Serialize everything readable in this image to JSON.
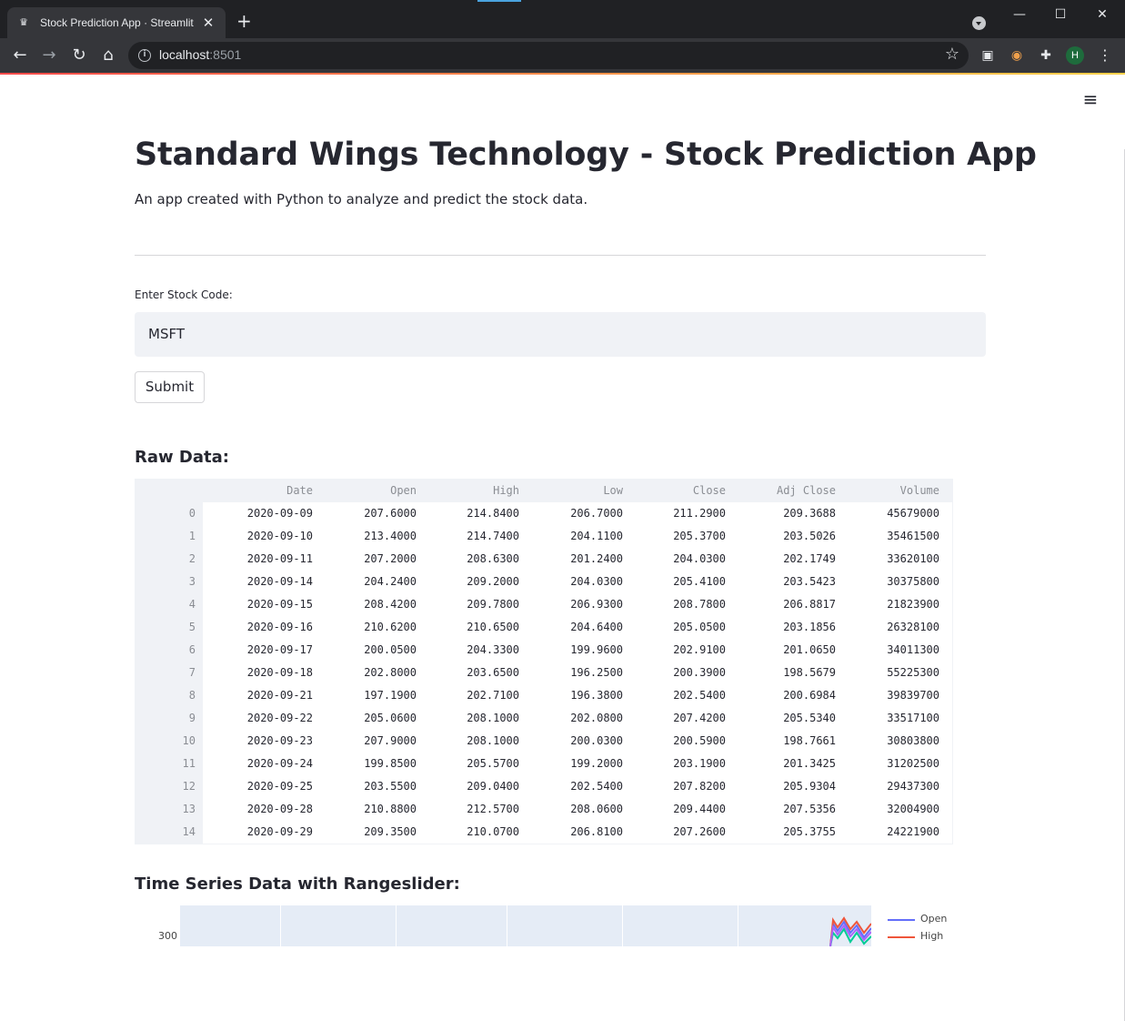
{
  "browser": {
    "tab_title": "Stock Prediction App · Streamlit",
    "tab_close": "✕",
    "new_tab": "+",
    "url_host": "localhost",
    "url_port": ":8501",
    "profile_initial": "H",
    "icons": [
      "back-arrow-icon",
      "forward-arrow-icon",
      "reload-icon",
      "home-icon",
      "info-icon",
      "star-icon",
      "reader-icon",
      "extension-icon",
      "puzzle-icon",
      "menu-dots-icon"
    ]
  },
  "app": {
    "title": "Standard Wings Technology - Stock Prediction App",
    "subtitle": "An app created with Python to analyze and predict the stock data.",
    "input_label": "Enter Stock Code:",
    "input_value": "MSFT",
    "submit_label": "Submit",
    "raw_data_heading": "Raw Data:",
    "chart_heading": "Time Series Data with Rangeslider:"
  },
  "table": {
    "columns": [
      "Date",
      "Open",
      "High",
      "Low",
      "Close",
      "Adj Close",
      "Volume"
    ],
    "rows": [
      [
        "0",
        "2020-09-09",
        "207.6000",
        "214.8400",
        "206.7000",
        "211.2900",
        "209.3688",
        "45679000"
      ],
      [
        "1",
        "2020-09-10",
        "213.4000",
        "214.7400",
        "204.1100",
        "205.3700",
        "203.5026",
        "35461500"
      ],
      [
        "2",
        "2020-09-11",
        "207.2000",
        "208.6300",
        "201.2400",
        "204.0300",
        "202.1749",
        "33620100"
      ],
      [
        "3",
        "2020-09-14",
        "204.2400",
        "209.2000",
        "204.0300",
        "205.4100",
        "203.5423",
        "30375800"
      ],
      [
        "4",
        "2020-09-15",
        "208.4200",
        "209.7800",
        "206.9300",
        "208.7800",
        "206.8817",
        "21823900"
      ],
      [
        "5",
        "2020-09-16",
        "210.6200",
        "210.6500",
        "204.6400",
        "205.0500",
        "203.1856",
        "26328100"
      ],
      [
        "6",
        "2020-09-17",
        "200.0500",
        "204.3300",
        "199.9600",
        "202.9100",
        "201.0650",
        "34011300"
      ],
      [
        "7",
        "2020-09-18",
        "202.8000",
        "203.6500",
        "196.2500",
        "200.3900",
        "198.5679",
        "55225300"
      ],
      [
        "8",
        "2020-09-21",
        "197.1900",
        "202.7100",
        "196.3800",
        "202.5400",
        "200.6984",
        "39839700"
      ],
      [
        "9",
        "2020-09-22",
        "205.0600",
        "208.1000",
        "202.0800",
        "207.4200",
        "205.5340",
        "33517100"
      ],
      [
        "10",
        "2020-09-23",
        "207.9000",
        "208.1000",
        "200.0300",
        "200.5900",
        "198.7661",
        "30803800"
      ],
      [
        "11",
        "2020-09-24",
        "199.8500",
        "205.5700",
        "199.2000",
        "203.1900",
        "201.3425",
        "31202500"
      ],
      [
        "12",
        "2020-09-25",
        "203.5500",
        "209.0400",
        "202.5400",
        "207.8200",
        "205.9304",
        "29437300"
      ],
      [
        "13",
        "2020-09-28",
        "210.8800",
        "212.5700",
        "208.0600",
        "209.4400",
        "207.5356",
        "32004900"
      ],
      [
        "14",
        "2020-09-29",
        "209.3500",
        "210.0700",
        "206.8100",
        "207.2600",
        "205.3755",
        "24221900"
      ]
    ]
  },
  "chart_data": {
    "type": "line",
    "title": "",
    "series": [
      {
        "name": "Open",
        "color": "#636efa"
      },
      {
        "name": "High",
        "color": "#ef553b"
      }
    ],
    "y_ticks": [
      "300"
    ],
    "note": "Chart is cut off at bottom of viewport; only top edge visible."
  }
}
